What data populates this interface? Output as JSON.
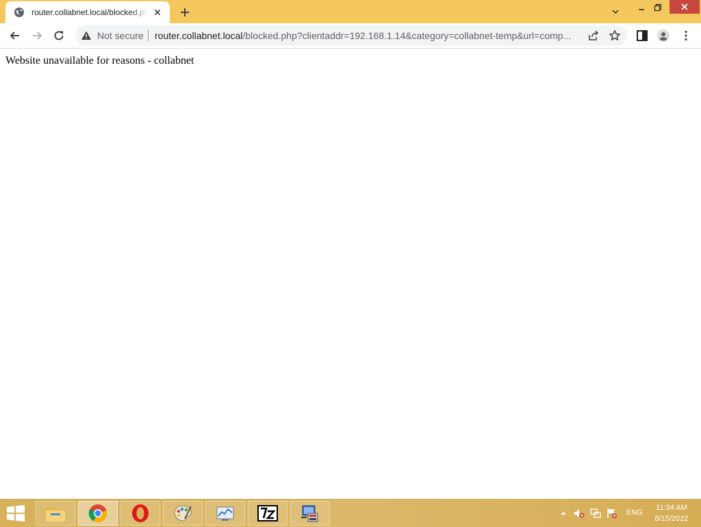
{
  "browser": {
    "tab": {
      "title": "router.collabnet.local/blocked.php"
    },
    "address_bar": {
      "security_label": "Not secure",
      "url_host": "router.collabnet.local",
      "url_rest": "/blocked.php?clientaddr=192.168.1.14&category=collabnet-temp&url=comp..."
    }
  },
  "page": {
    "message": "Website unavailable for reasons - collabnet"
  },
  "taskbar": {
    "apps": [
      "file-explorer",
      "chrome",
      "opera",
      "paint",
      "performance-monitor",
      "7-zip",
      "control-panel-app"
    ],
    "active_app": "chrome",
    "language": "ENG",
    "time": "11:34 AM",
    "date": "8/15/2022"
  },
  "colors": {
    "titlebar": "#f5c85e",
    "close_button": "#c7463d",
    "taskbar": "#d7b25a"
  }
}
